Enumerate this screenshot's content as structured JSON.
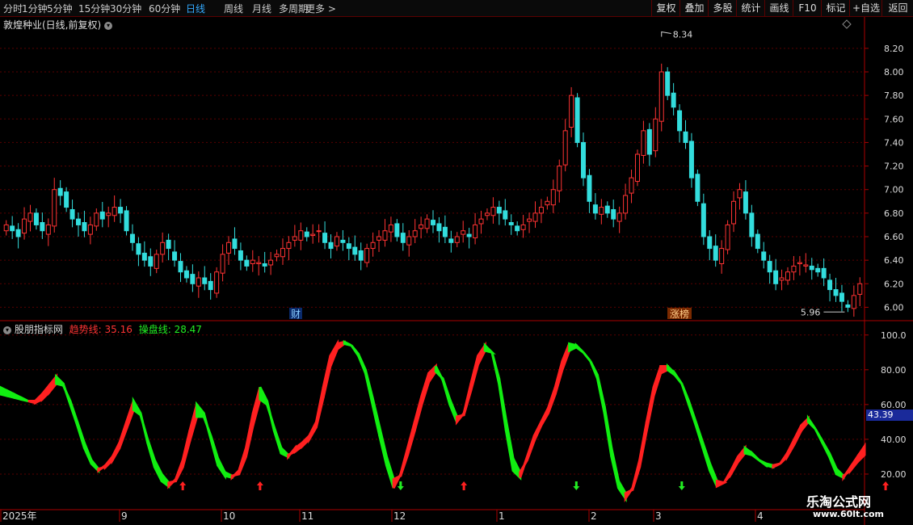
{
  "toolbar": {
    "periods": [
      "分时",
      "1分钟",
      "5分钟",
      "15分钟",
      "30分钟",
      "60分钟",
      "日线",
      "周线",
      "月线",
      "多周期",
      "更多 >"
    ],
    "active_period": "日线",
    "right_buttons": [
      "复权",
      "叠加",
      "多股",
      "统计",
      "画线",
      "F10",
      "标记",
      "+自选",
      "返回"
    ]
  },
  "main_chart": {
    "title": "敦煌种业(日线,前复权)",
    "y_ticks": [
      "8.20",
      "8.00",
      "7.80",
      "7.60",
      "7.40",
      "7.20",
      "7.00",
      "6.80",
      "6.60",
      "6.40",
      "6.20",
      "6.00"
    ],
    "high_label": "8.34",
    "low_label": "5.96",
    "markers": [
      "财",
      "涨榜"
    ]
  },
  "indicator": {
    "name": "股朋指标网",
    "line1_label": "趋势线: 35.16",
    "line2_label": "操盘线: 28.47",
    "y_ticks": [
      "100.0",
      "80.00",
      "60.00",
      "40.00",
      "20.00"
    ],
    "current_value": "43.39",
    "signals": [
      {
        "dir": "up",
        "index": 26
      },
      {
        "dir": "up",
        "index": 37
      },
      {
        "dir": "down",
        "index": 57
      },
      {
        "dir": "up",
        "index": 66
      },
      {
        "dir": "down",
        "index": 82
      },
      {
        "dir": "down",
        "index": 97
      },
      {
        "dir": "up",
        "index": 126
      }
    ]
  },
  "x_axis": {
    "labels": [
      "2025年",
      "9",
      "10",
      "11",
      "12",
      "1",
      "2",
      "3",
      "4"
    ]
  },
  "watermark": {
    "line1": "乐淘公式网",
    "line2": "www.60lt.com"
  },
  "colors": {
    "up": "#ff3333",
    "down": "#33dddd",
    "grid": "#5a0000",
    "trend_up": "#ff2020",
    "trend_down": "#11ee11"
  },
  "chart_data": {
    "type": "candlestick",
    "x_labels": [
      "2025年",
      "9",
      "10",
      "11",
      "12",
      "1",
      "2",
      "3",
      "4"
    ],
    "price_ylim": [
      5.9,
      8.35
    ],
    "closes": [
      6.7,
      6.65,
      6.6,
      6.75,
      6.8,
      6.7,
      6.65,
      6.7,
      7.0,
      6.95,
      6.85,
      6.75,
      6.7,
      6.65,
      6.7,
      6.8,
      6.75,
      6.8,
      6.85,
      6.8,
      6.65,
      6.55,
      6.45,
      6.4,
      6.35,
      6.45,
      6.55,
      6.5,
      6.4,
      6.3,
      6.25,
      6.2,
      6.25,
      6.2,
      6.15,
      6.3,
      6.45,
      6.55,
      6.5,
      6.4,
      6.35,
      6.4,
      6.38,
      6.35,
      6.4,
      6.45,
      6.5,
      6.55,
      6.6,
      6.65,
      6.6,
      6.62,
      6.65,
      6.55,
      6.5,
      6.6,
      6.55,
      6.5,
      6.45,
      6.4,
      6.5,
      6.55,
      6.6,
      6.65,
      6.7,
      6.6,
      6.55,
      6.6,
      6.65,
      6.7,
      6.75,
      6.7,
      6.65,
      6.6,
      6.55,
      6.6,
      6.65,
      6.6,
      6.7,
      6.75,
      6.8,
      6.85,
      6.8,
      6.75,
      6.7,
      6.65,
      6.7,
      6.75,
      6.8,
      6.85,
      6.9,
      7.0,
      7.2,
      7.5,
      7.8,
      7.4,
      7.1,
      6.9,
      6.8,
      6.85,
      6.8,
      6.75,
      6.8,
      6.95,
      7.1,
      7.3,
      7.5,
      7.3,
      7.6,
      8.0,
      7.8,
      7.7,
      7.5,
      7.4,
      7.1,
      6.9,
      6.6,
      6.5,
      6.4,
      6.5,
      6.7,
      6.9,
      7.0,
      6.8,
      6.6,
      6.5,
      6.4,
      6.3,
      6.2,
      6.25,
      6.3,
      6.35,
      6.38,
      6.36,
      6.32,
      6.3,
      6.25,
      6.15,
      6.1,
      6.05,
      6.0,
      6.1,
      6.2
    ],
    "series": [
      {
        "name": "趋势线",
        "values": [
          70,
          68,
          66,
          64,
          62,
          62,
          66,
          71,
          76,
          72,
          60,
          48,
          35,
          26,
          22,
          25,
          30,
          38,
          50,
          62,
          55,
          38,
          24,
          16,
          13,
          17,
          28,
          45,
          60,
          55,
          40,
          25,
          19,
          18,
          22,
          35,
          55,
          70,
          62,
          45,
          32,
          30,
          35,
          38,
          42,
          50,
          70,
          88,
          95,
          96,
          94,
          88,
          78,
          60,
          42,
          25,
          12,
          20,
          35,
          50,
          65,
          78,
          82,
          74,
          60,
          50,
          55,
          72,
          88,
          94,
          90,
          72,
          45,
          22,
          18,
          30,
          42,
          50,
          58,
          70,
          85,
          95,
          94,
          90,
          85,
          75,
          55,
          30,
          12,
          6,
          12,
          28,
          50,
          70,
          82,
          82,
          78,
          72,
          60,
          48,
          35,
          22,
          13,
          15,
          22,
          30,
          35,
          32,
          28,
          25,
          24,
          26,
          32,
          40,
          48,
          52,
          46,
          38,
          30,
          20,
          18,
          24,
          30,
          36
        ]
      },
      {
        "name": "操盘线",
        "values": [
          66,
          65,
          64,
          63,
          62,
          61,
          63,
          67,
          72,
          71,
          62,
          50,
          38,
          28,
          23,
          24,
          28,
          35,
          46,
          57,
          54,
          40,
          28,
          20,
          15,
          16,
          24,
          39,
          53,
          53,
          42,
          29,
          21,
          19,
          20,
          30,
          48,
          63,
          60,
          47,
          35,
          31,
          33,
          36,
          40,
          47,
          64,
          82,
          92,
          95,
          94,
          89,
          80,
          64,
          47,
          30,
          17,
          19,
          31,
          45,
          60,
          73,
          79,
          75,
          63,
          53,
          54,
          68,
          83,
          91,
          90,
          75,
          51,
          29,
          21,
          28,
          39,
          48,
          55,
          66,
          80,
          91,
          93,
          90,
          85,
          77,
          59,
          35,
          16,
          9,
          11,
          24,
          45,
          65,
          78,
          80,
          77,
          72,
          62,
          50,
          38,
          26,
          16,
          15,
          20,
          27,
          32,
          31,
          28,
          26,
          25,
          26,
          30,
          37,
          45,
          50,
          46,
          39,
          32,
          23,
          19,
          22,
          27,
          31
        ]
      }
    ],
    "indicator_ylim": [
      0,
      105
    ]
  }
}
